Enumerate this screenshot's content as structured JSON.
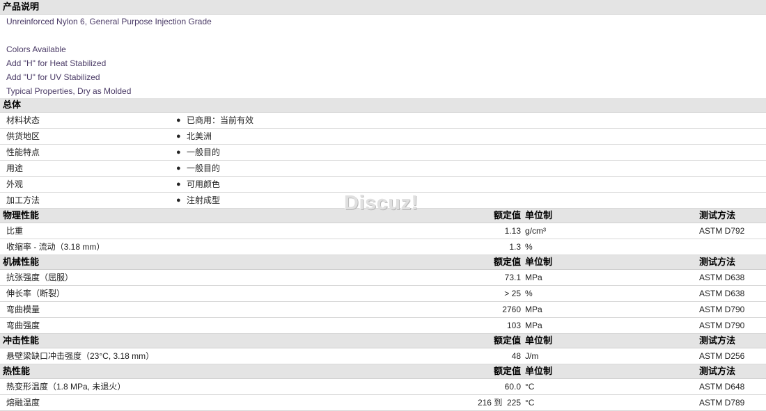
{
  "description": {
    "title": "产品说明",
    "lines": [
      "Unreinforced Nylon 6, General Purpose Injection Grade",
      "",
      "Colors Available",
      "Add \"H\" for Heat Stabilized",
      "Add \"U\" for UV Stabilized",
      "Typical Properties, Dry as Molded"
    ]
  },
  "general": {
    "title": "总体",
    "rows": [
      {
        "label": "材料状态",
        "value": "已商用：当前有效"
      },
      {
        "label": "供货地区",
        "value": "北美洲"
      },
      {
        "label": "性能特点",
        "value": "一般目的"
      },
      {
        "label": "用途",
        "value": "一般目的"
      },
      {
        "label": "外观",
        "value": "可用颜色"
      },
      {
        "label": "加工方法",
        "value": "注射成型"
      }
    ]
  },
  "headers": {
    "value": "额定值",
    "unit": "单位制",
    "method": "测试方法"
  },
  "physical": {
    "title": "物理性能",
    "rows": [
      {
        "label": "比重",
        "value": "1.13",
        "unit": "g/cm³",
        "method": "ASTM D792"
      },
      {
        "label": "收缩率 - 流动（3.18 mm）",
        "value": "1.3",
        "unit": "%",
        "method": ""
      }
    ]
  },
  "mechanical": {
    "title": "机械性能",
    "rows": [
      {
        "label": "抗张强度（屈服）",
        "value": "73.1",
        "unit": "MPa",
        "method": "ASTM D638"
      },
      {
        "label": "伸长率（断裂）",
        "value": "> 25",
        "unit": "%",
        "method": "ASTM D638"
      },
      {
        "label": "弯曲模量",
        "value": "2760",
        "unit": "MPa",
        "method": "ASTM D790"
      },
      {
        "label": "弯曲强度",
        "value": "103",
        "unit": "MPa",
        "method": "ASTM D790"
      }
    ]
  },
  "impact": {
    "title": "冲击性能",
    "rows": [
      {
        "label": "悬壁梁缺口冲击强度（23°C, 3.18 mm）",
        "value": "48",
        "unit": "J/m",
        "method": "ASTM D256"
      }
    ]
  },
  "thermal": {
    "title": "热性能",
    "rows": [
      {
        "label": "热变形温度（1.8 MPa, 未退火）",
        "value": "60.0",
        "unit": "°C",
        "method": "ASTM D648"
      },
      {
        "label": "熔融温度",
        "value": "216 到  225",
        "unit": "°C",
        "method": "ASTM D789"
      }
    ]
  },
  "watermark": "Discuz!",
  "bullet": "●"
}
